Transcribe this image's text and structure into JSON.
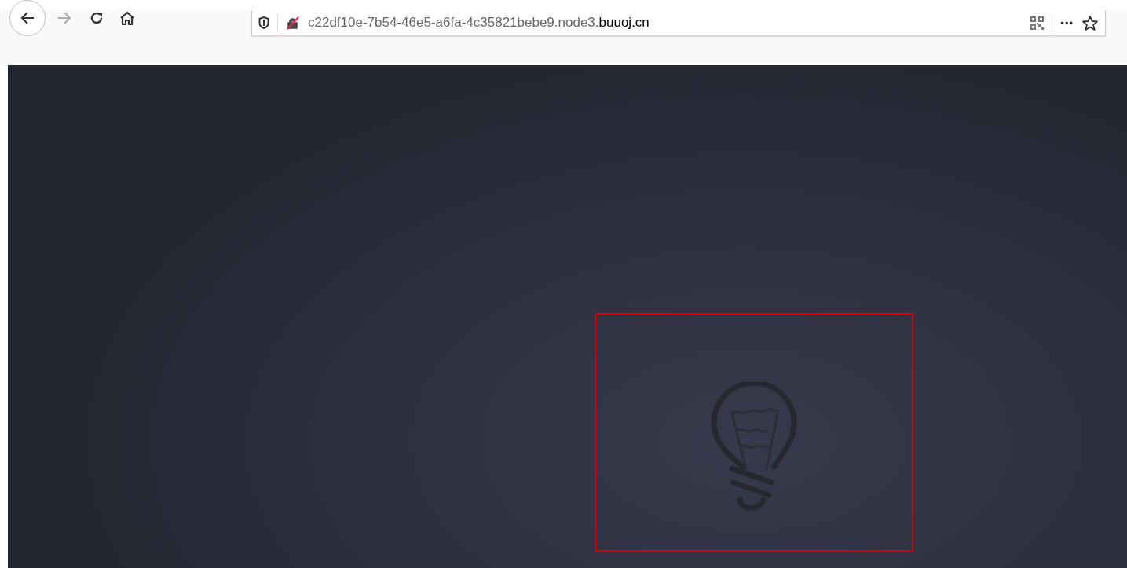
{
  "toolbar": {
    "url": {
      "prefix": "c22df10e-7b54-46e5-a6fa-4c35821bebe9.node3.",
      "domain": "buuoj.cn"
    },
    "menu_label": "•••"
  },
  "page": {
    "kind": "bulb"
  }
}
